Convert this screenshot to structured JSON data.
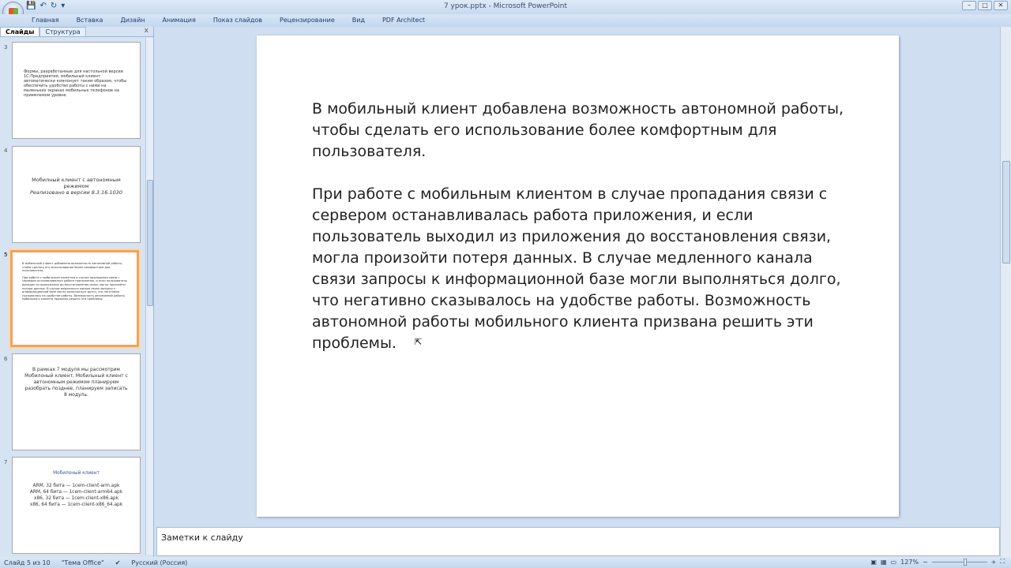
{
  "window": {
    "title": "7 урок.pptx - Microsoft PowerPoint",
    "controls": [
      "–",
      "□",
      "✕"
    ]
  },
  "ribbon": {
    "tabs": [
      "Главная",
      "Вставка",
      "Дизайн",
      "Анимация",
      "Показ слайдов",
      "Рецензирование",
      "Вид",
      "PDF Architect"
    ]
  },
  "panel": {
    "tabs": [
      "Слайды",
      "Структура"
    ],
    "close": "x"
  },
  "thumbnails": [
    {
      "num": "3",
      "text": "Формы, разработанные для настольной версии 1С:Предприятия, мобильный клиент автоматически компонует таким образом, чтобы обеспечить удобство работы с ними на маленьких экранах мобильных телефонов на приемлемом уровне."
    },
    {
      "num": "4",
      "title": "Мобилный клиент с автономным режимом",
      "subtitle": "Реализовано в версии 8.3.16.1030"
    },
    {
      "num": "5"
    },
    {
      "num": "6",
      "text": "В рамках 7 модуля мы рассмотрим Мобилоный клиент, Мобильный клиент с автономным режимом планируем разобрать позднее, планируем записать 8 модуль."
    },
    {
      "num": "7",
      "title": "Мобилоный клиент",
      "lines": [
        "ARM, 32 бита — 1cem-client-arm.apk",
        "ARM, 64 бита — 1cem-client-arm64.apk",
        "x86, 32 бита — 1cem-client-x86.apk",
        "x86, 64 бита — 1cem-client-x86_64.apk"
      ]
    }
  ],
  "slide": {
    "paragraphs": [
      "В мобильный клиент добавлена возможность автономной работы, чтобы сделать его использование более комфортным для пользователя.",
      "При работе с мобильным клиентом в случае пропадания связи с сервером останавливалась работа приложения, и если пользователь выходил из приложения до восстановления связи, могла произойти потеря данных. В случае медленного канала связи запросы к информационной базе могли выполняться долго, что негативно сказывалось на удобстве работы. Возможность автономной работы мобильного клиента призвана решить эти проблемы."
    ]
  },
  "notes": {
    "placeholder": "Заметки к слайду"
  },
  "status": {
    "slide": "Слайд 5 из 10",
    "theme": "\"Тема Office\"",
    "language": "Русский (Россия)",
    "zoom": "127%",
    "zoom_minus": "−",
    "zoom_plus": "+"
  }
}
